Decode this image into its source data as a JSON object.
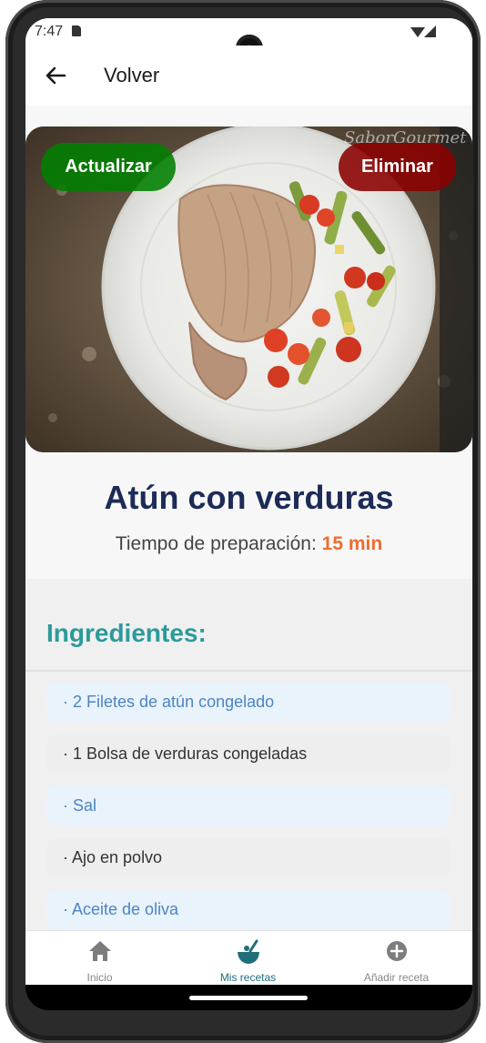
{
  "status_bar": {
    "time": "7:47"
  },
  "app_bar": {
    "back_label": "Volver"
  },
  "recipe": {
    "update_label": "Actualizar",
    "delete_label": "Eliminar",
    "title": "Atún con verduras",
    "prep_label": "Tiempo de preparación:",
    "prep_value": "15 min",
    "photo_watermark": "SaborGourmet"
  },
  "ingredients": {
    "header": "Ingredientes:",
    "items": [
      "· 2 Filetes de atún congelado",
      "· 1 Bolsa de verduras congeladas",
      "· Sal",
      "· Ajo en polvo",
      "· Aceite de oliva"
    ]
  },
  "bottom_nav": {
    "items": [
      {
        "label": "Inicio",
        "icon": "home-icon"
      },
      {
        "label": "Mis recetas",
        "icon": "bowl-icon"
      },
      {
        "label": "Añadir receta",
        "icon": "add-circle-icon"
      }
    ],
    "active_index": 1
  },
  "colors": {
    "title": "#1c2b57",
    "accent_orange": "#ef6b2f",
    "ingredients_header": "#2c9a9a",
    "update_button": "#008000",
    "delete_button": "#8b0000"
  }
}
